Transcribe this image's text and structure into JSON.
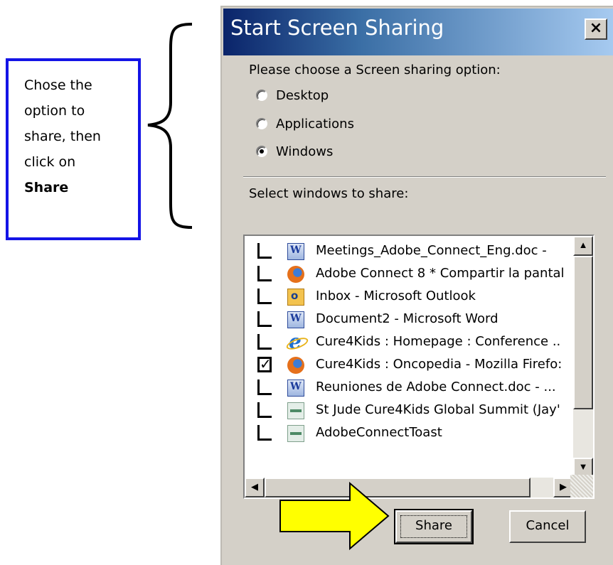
{
  "annotation": {
    "lines": [
      "Chose the",
      "option to",
      "share, then",
      "click on"
    ],
    "bold_word": "Share"
  },
  "dialog": {
    "title": "Start Screen Sharing",
    "close_label": "×",
    "prompt": "Please choose a Screen sharing option:",
    "options": [
      {
        "label": "Desktop",
        "selected": false
      },
      {
        "label": "Applications",
        "selected": false
      },
      {
        "label": "Windows",
        "selected": true
      }
    ],
    "select_label": "Select windows to share:",
    "windows": [
      {
        "label": "Meetings_Adobe_Connect_Eng.doc -",
        "icon": "word-icon",
        "checked": false
      },
      {
        "label": "Adobe Connect 8 * Compartir la pantal",
        "icon": "firefox-icon",
        "checked": false
      },
      {
        "label": "Inbox - Microsoft Outlook",
        "icon": "outlook-icon",
        "checked": false
      },
      {
        "label": "Document2 - Microsoft Word",
        "icon": "word-icon",
        "checked": false
      },
      {
        "label": "Cure4Kids : Homepage : Conference ..",
        "icon": "ie-icon",
        "checked": false
      },
      {
        "label": "Cure4Kids : Oncopedia - Mozilla Firefo:",
        "icon": "firefox-icon",
        "checked": true
      },
      {
        "label": "Reuniones de Adobe Connect.doc - ...",
        "icon": "word-icon",
        "checked": false
      },
      {
        "label": "St Jude Cure4Kids Global Summit (Jay'",
        "icon": "generic-window-icon",
        "checked": false
      },
      {
        "label": "AdobeConnectToast",
        "icon": "generic-window-icon",
        "checked": false
      }
    ],
    "share_label": "Share",
    "cancel_label": "Cancel"
  }
}
